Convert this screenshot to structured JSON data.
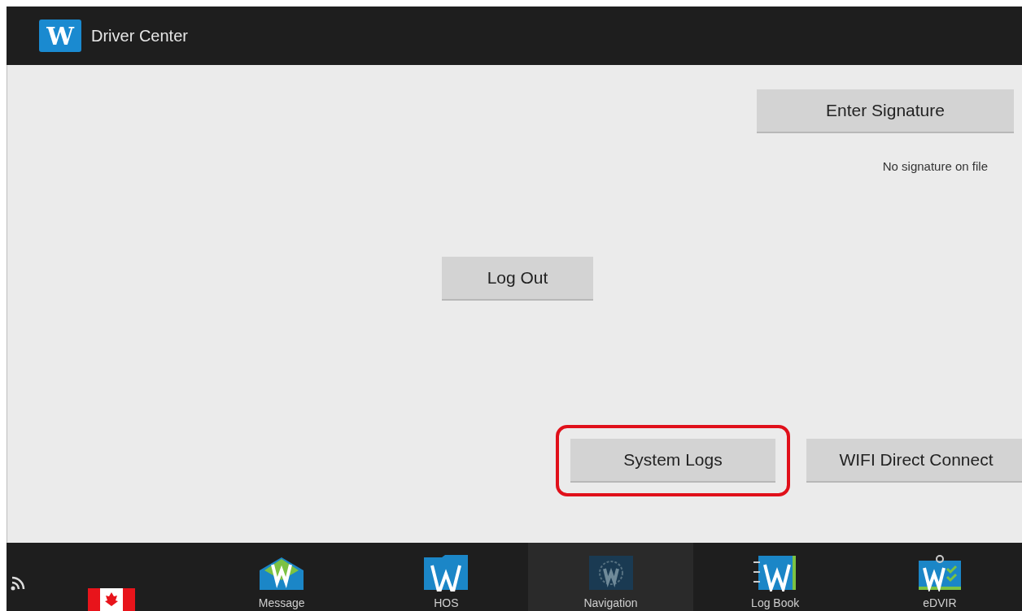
{
  "title_bar": {
    "logo": "W",
    "title": "Driver Center"
  },
  "signature": {
    "button": "Enter Signature",
    "status": "No signature on file"
  },
  "logout_button": "Log Out",
  "bottom_buttons": [
    {
      "label": "System Logs",
      "highlighted": true
    },
    {
      "label": "WIFI Direct Connect",
      "highlighted": false
    }
  ],
  "nav_bar": {
    "items": [
      {
        "label": "Message",
        "kind": "message",
        "selected": false
      },
      {
        "label": "HOS",
        "kind": "hos",
        "selected": false
      },
      {
        "label": "Navigation",
        "kind": "navigation",
        "selected": true
      },
      {
        "label": "Log Book",
        "kind": "logbook",
        "selected": false
      },
      {
        "label": "eDVIR",
        "kind": "edvir",
        "selected": false
      }
    ]
  }
}
